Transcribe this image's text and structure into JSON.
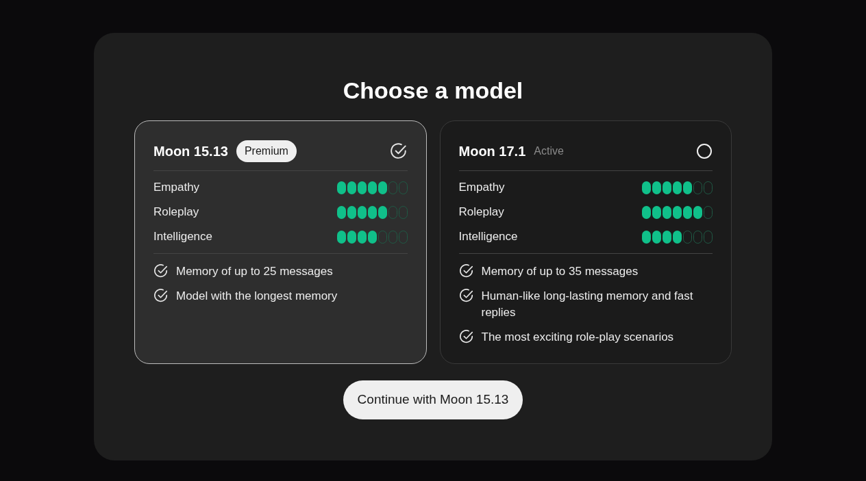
{
  "title": "Choose a model",
  "models": [
    {
      "name": "Moon 15.13",
      "badge": {
        "text": "Premium",
        "kind": "pill"
      },
      "selected": true,
      "ratings": [
        {
          "label": "Empathy",
          "stars": 5
        },
        {
          "label": "Roleplay",
          "stars": 5
        },
        {
          "label": "Intelligence",
          "stars": 4
        }
      ],
      "features": [
        "Memory of up to 25 messages",
        "Model with the longest memory"
      ]
    },
    {
      "name": "Moon 17.1",
      "badge": {
        "text": "Active",
        "kind": "plain"
      },
      "selected": false,
      "ratings": [
        {
          "label": "Empathy",
          "stars": 5
        },
        {
          "label": "Roleplay",
          "stars": 6
        },
        {
          "label": "Intelligence",
          "stars": 4
        }
      ],
      "features": [
        "Memory of up to 35 messages",
        "Human-like long-lasting memory and fast replies",
        "The most exciting role-play scenarios"
      ]
    }
  ],
  "continue_button": "Continue with Moon 15.13"
}
